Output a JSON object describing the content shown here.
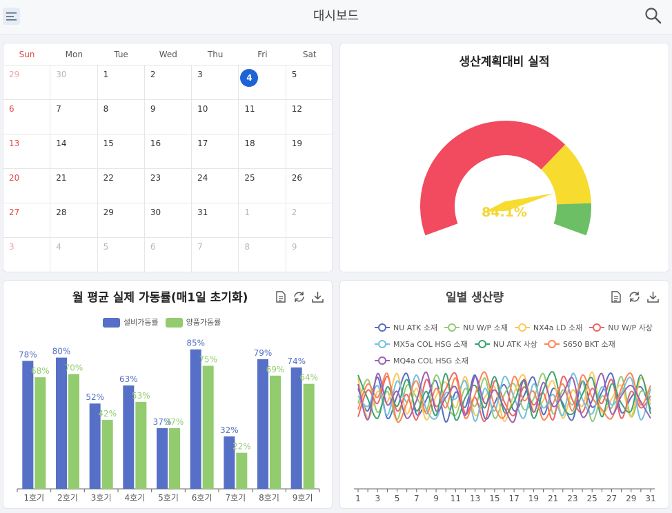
{
  "header": {
    "title": "대시보드",
    "menu_icon": "hamburger-menu-icon",
    "search_icon": "search-icon"
  },
  "calendar": {
    "weekdays": [
      "Sun",
      "Mon",
      "Tue",
      "Wed",
      "Thu",
      "Fri",
      "Sat"
    ],
    "today": "4",
    "weeks": [
      [
        "29",
        "30",
        "1",
        "2",
        "3",
        "4",
        "5"
      ],
      [
        "6",
        "7",
        "8",
        "9",
        "10",
        "11",
        "12"
      ],
      [
        "13",
        "14",
        "15",
        "16",
        "17",
        "18",
        "19"
      ],
      [
        "20",
        "21",
        "22",
        "23",
        "24",
        "25",
        "26"
      ],
      [
        "27",
        "28",
        "29",
        "30",
        "31",
        "1",
        "2"
      ],
      [
        "3",
        "4",
        "5",
        "6",
        "7",
        "8",
        "9"
      ]
    ]
  },
  "gauge": {
    "title": "생산계획대비 실적",
    "value_label": "84.1%",
    "value": 84.1,
    "colors": {
      "red": "#f24a5e",
      "yellow": "#f7dc2f",
      "green": "#6cbf64"
    }
  },
  "bar_panel": {
    "title": "월 평균 실제 가동률(매1일 초기화)",
    "tool_icons": [
      "document-icon",
      "refresh-icon",
      "download-icon"
    ]
  },
  "line_panel": {
    "title": "일별 생산량",
    "tool_icons": [
      "document-icon",
      "refresh-icon",
      "download-icon"
    ]
  },
  "chart_data": [
    {
      "type": "bar",
      "categories": [
        "1호기",
        "2호기",
        "3호기",
        "4호기",
        "5호기",
        "6호기",
        "7호기",
        "8호기",
        "9호기"
      ],
      "series": [
        {
          "name": "설비가동률",
          "color": "#5570c6",
          "values": [
            78,
            80,
            52,
            63,
            37,
            85,
            32,
            79,
            74
          ]
        },
        {
          "name": "양품가동률",
          "color": "#92cc6f",
          "values": [
            68,
            70,
            42,
            53,
            37,
            75,
            22,
            69,
            64
          ]
        }
      ],
      "value_suffix": "%",
      "ylim": [
        0,
        100
      ]
    },
    {
      "type": "line",
      "x": [
        1,
        2,
        3,
        4,
        5,
        6,
        7,
        8,
        9,
        10,
        11,
        12,
        13,
        14,
        15,
        16,
        17,
        18,
        19,
        20,
        21,
        22,
        23,
        24,
        25,
        26,
        27,
        28,
        29,
        30,
        31
      ],
      "xticks": [
        "1",
        "3",
        "5",
        "7",
        "9",
        "11",
        "13",
        "15",
        "17",
        "19",
        "21",
        "23",
        "25",
        "27",
        "29",
        "31"
      ],
      "ylim": [
        0,
        100
      ],
      "series": [
        {
          "name": "NU ATK 소재",
          "color": "#5470c6",
          "values": [
            70,
            40,
            85,
            30,
            60,
            90,
            35,
            55,
            80,
            25,
            65,
            45,
            88,
            30,
            50,
            75,
            40,
            60,
            85,
            35,
            70,
            50,
            28,
            80,
            45,
            65,
            90,
            38,
            58,
            72,
            42
          ]
        },
        {
          "name": "NU W/P 소재",
          "color": "#91cc75",
          "values": [
            50,
            82,
            38,
            66,
            28,
            74,
            58,
            40,
            88,
            52,
            34,
            70,
            46,
            84,
            30,
            62,
            76,
            42,
            56,
            90,
            36,
            68,
            48,
            80,
            26,
            60,
            44,
            86,
            32,
            66,
            54
          ]
        },
        {
          "name": "NX4a LD 소재",
          "color": "#fac858",
          "values": [
            84,
            30,
            66,
            52,
            90,
            36,
            70,
            28,
            60,
            78,
            44,
            86,
            34,
            58,
            72,
            26,
            64,
            88,
            40,
            54,
            80,
            30,
            68,
            46,
            92,
            38,
            56,
            74,
            32,
            84,
            48
          ]
        },
        {
          "name": "NU W/P 사상",
          "color": "#ee6666",
          "values": [
            32,
            68,
            50,
            86,
            40,
            62,
            28,
            82,
            46,
            70,
            90,
            36,
            58,
            26,
            80,
            52,
            34,
            72,
            48,
            64,
            28,
            86,
            54,
            38,
            70,
            50,
            82,
            30,
            66,
            44,
            60
          ]
        },
        {
          "name": "MX5a COL HSG 소재",
          "color": "#73c0de",
          "values": [
            60,
            46,
            74,
            34,
            80,
            52,
            88,
            42,
            30,
            64,
            56,
            80,
            26,
            70,
            40,
            86,
            58,
            30,
            76,
            44,
            62,
            34,
            90,
            56,
            36,
            72,
            48,
            64,
            84,
            28,
            70
          ]
        },
        {
          "name": "NU ATK 사상",
          "color": "#3ba272",
          "values": [
            88,
            56,
            30,
            72,
            46,
            82,
            40,
            66,
            34,
            90,
            28,
            58,
            74,
            44,
            86,
            38,
            52,
            80,
            30,
            68,
            92,
            46,
            36,
            62,
            84,
            32,
            76,
            50,
            40,
            88,
            36
          ]
        },
        {
          "name": "S650 BKT 소재",
          "color": "#fc8452",
          "values": [
            42,
            76,
            58,
            90,
            26,
            50,
            80,
            36,
            70,
            44,
            84,
            30,
            62,
            92,
            46,
            32,
            86,
            54,
            66,
            28,
            50,
            76,
            40,
            88,
            58,
            42,
            30,
            70,
            90,
            48,
            74
          ]
        },
        {
          "name": "MQ4a COL HSG 소재",
          "color": "#9a60b4",
          "values": [
            76,
            28,
            90,
            48,
            66,
            30,
            54,
            92,
            40,
            58,
            72,
            34,
            86,
            50,
            68,
            44,
            26,
            82,
            38,
            78,
            46,
            62,
            84,
            32,
            54,
            90,
            36,
            60,
            74,
            52,
            30
          ]
        }
      ]
    }
  ]
}
